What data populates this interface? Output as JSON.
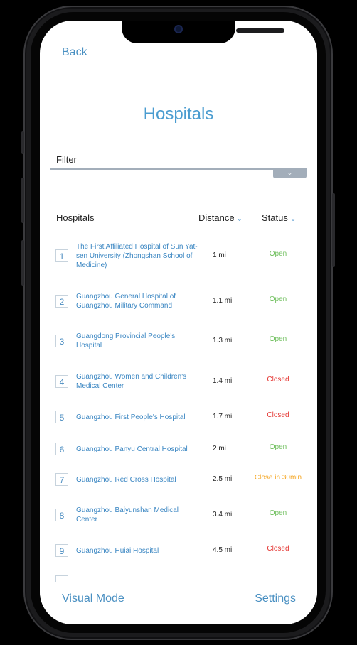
{
  "nav": {
    "back_label": "Back"
  },
  "page": {
    "title": "Hospitals"
  },
  "filter": {
    "label": "Filter",
    "toggle_icon": "chevron-double-down"
  },
  "table": {
    "headers": {
      "name": "Hospitals",
      "distance": "Distance",
      "status": "Status"
    },
    "rows": [
      {
        "num": "1",
        "name": "The First Affiliated Hospital of Sun Yat-sen University (Zhongshan School of Medicine)",
        "distance": "1 mi",
        "status": "Open",
        "status_color": "#6ebf5c"
      },
      {
        "num": "2",
        "name": "Guangzhou General Hospital of Guangzhou Military Command",
        "distance": "1.1 mi",
        "status": "Open",
        "status_color": "#6ebf5c"
      },
      {
        "num": "3",
        "name": "Guangdong Provincial People's Hospital",
        "distance": "1.3 mi",
        "status": "Open",
        "status_color": "#6ebf5c"
      },
      {
        "num": "4",
        "name": "Guangzhou Women and Children's Medical Center",
        "distance": "1.4 mi",
        "status": "Closed",
        "status_color": "#e53935"
      },
      {
        "num": "5",
        "name": "Guangzhou First People's Hospital",
        "distance": "1.7 mi",
        "status": "Closed",
        "status_color": "#e53935"
      },
      {
        "num": "6",
        "name": "Guangzhou Panyu Central Hospital",
        "distance": "2 mi",
        "status": "Open",
        "status_color": "#6ebf5c"
      },
      {
        "num": "7",
        "name": "Guangzhou Red Cross Hospital",
        "distance": "2.5 mi",
        "status": "Close in 30min",
        "status_color": "#f5a623"
      },
      {
        "num": "8",
        "name": "Guangzhou Baiyunshan Medical Center",
        "distance": "3.4 mi",
        "status": "Open",
        "status_color": "#6ebf5c"
      },
      {
        "num": "9",
        "name": "Guangzhou Huiai Hospital",
        "distance": "4.5 mi",
        "status": "Closed",
        "status_color": "#e53935"
      }
    ]
  },
  "bottom": {
    "left_label": "Visual Mode",
    "right_label": "Settings"
  },
  "colors": {
    "accent": "#4a90c2",
    "open": "#6ebf5c",
    "closed": "#e53935",
    "warning": "#f5a623"
  }
}
